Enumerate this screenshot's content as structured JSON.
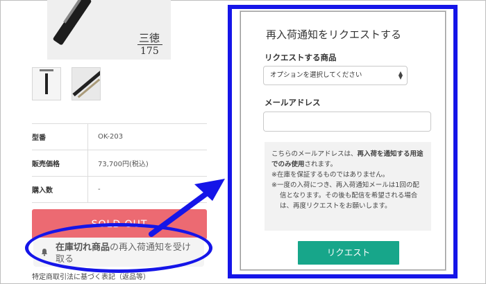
{
  "product": {
    "image_kanji": "三徳",
    "image_number": "175",
    "specs": [
      {
        "label": "型番",
        "value": "OK-203"
      },
      {
        "label": "販売価格",
        "value": "73,700円(税込)"
      },
      {
        "label": "購入数",
        "value": "-"
      }
    ],
    "soldout_label": "SOLD OUT",
    "notify_bold": "在庫切れ商品",
    "notify_rest": "の再入荷通知を受け取る",
    "footnote": "特定商取引法に基づく表記（返品等）"
  },
  "form": {
    "title": "再入荷通知をリクエストする",
    "product_label": "リクエストする商品",
    "select_value": "オプションを選択してください",
    "email_label": "メールアドレス",
    "email_value": "",
    "note_line1_pre": "こちらのメールアドレスは、",
    "note_line1_bold1": "再入荷を通知する用途でのみ使用",
    "note_line1_post": "されます。",
    "note_line2": "※在庫を保証するものではありません。",
    "note_line3": "※一度の入荷につき、再入荷通知メールは1回の配信となります。その後も配信を希望される場合は、再度リクエストをお願いします。",
    "request_button": "リクエスト"
  },
  "colors": {
    "annotation_blue": "#1515e8",
    "soldout_red": "#ec6a72",
    "request_green": "#17a68a"
  },
  "icons": {
    "bell": "bell-icon",
    "chevron": "chevron-updown-icon",
    "arrow": "arrow-icon"
  }
}
